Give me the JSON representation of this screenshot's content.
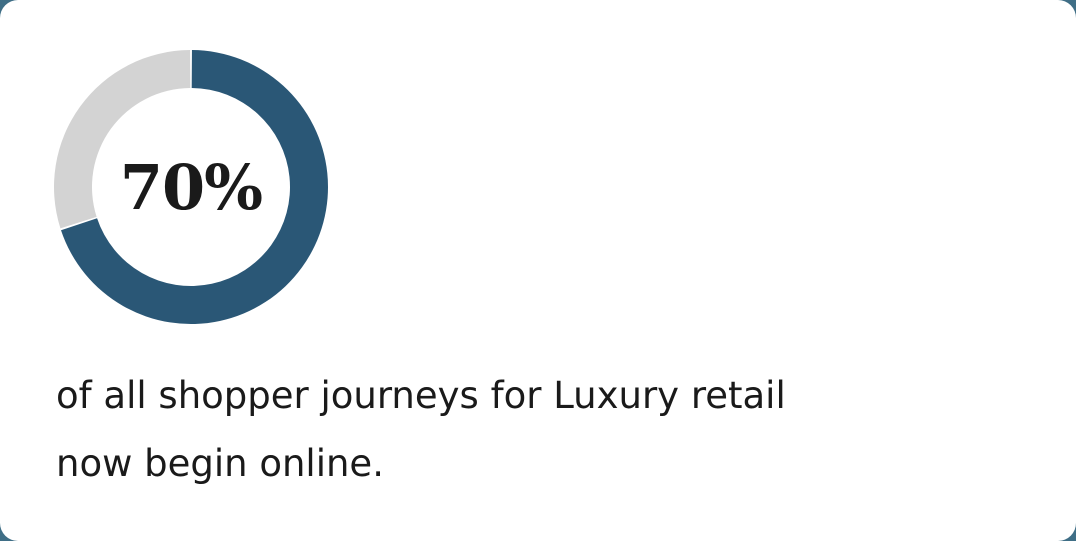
{
  "stat": {
    "value_label": "70%",
    "caption_line1": "of all shopper journeys for Luxury retail",
    "caption_line2": "now begin online."
  },
  "chart_data": {
    "type": "pie",
    "style": "donut",
    "slices": [
      {
        "value": 70,
        "color": "#2a5776"
      },
      {
        "value": 30,
        "color": "#d3d3d3"
      }
    ]
  }
}
